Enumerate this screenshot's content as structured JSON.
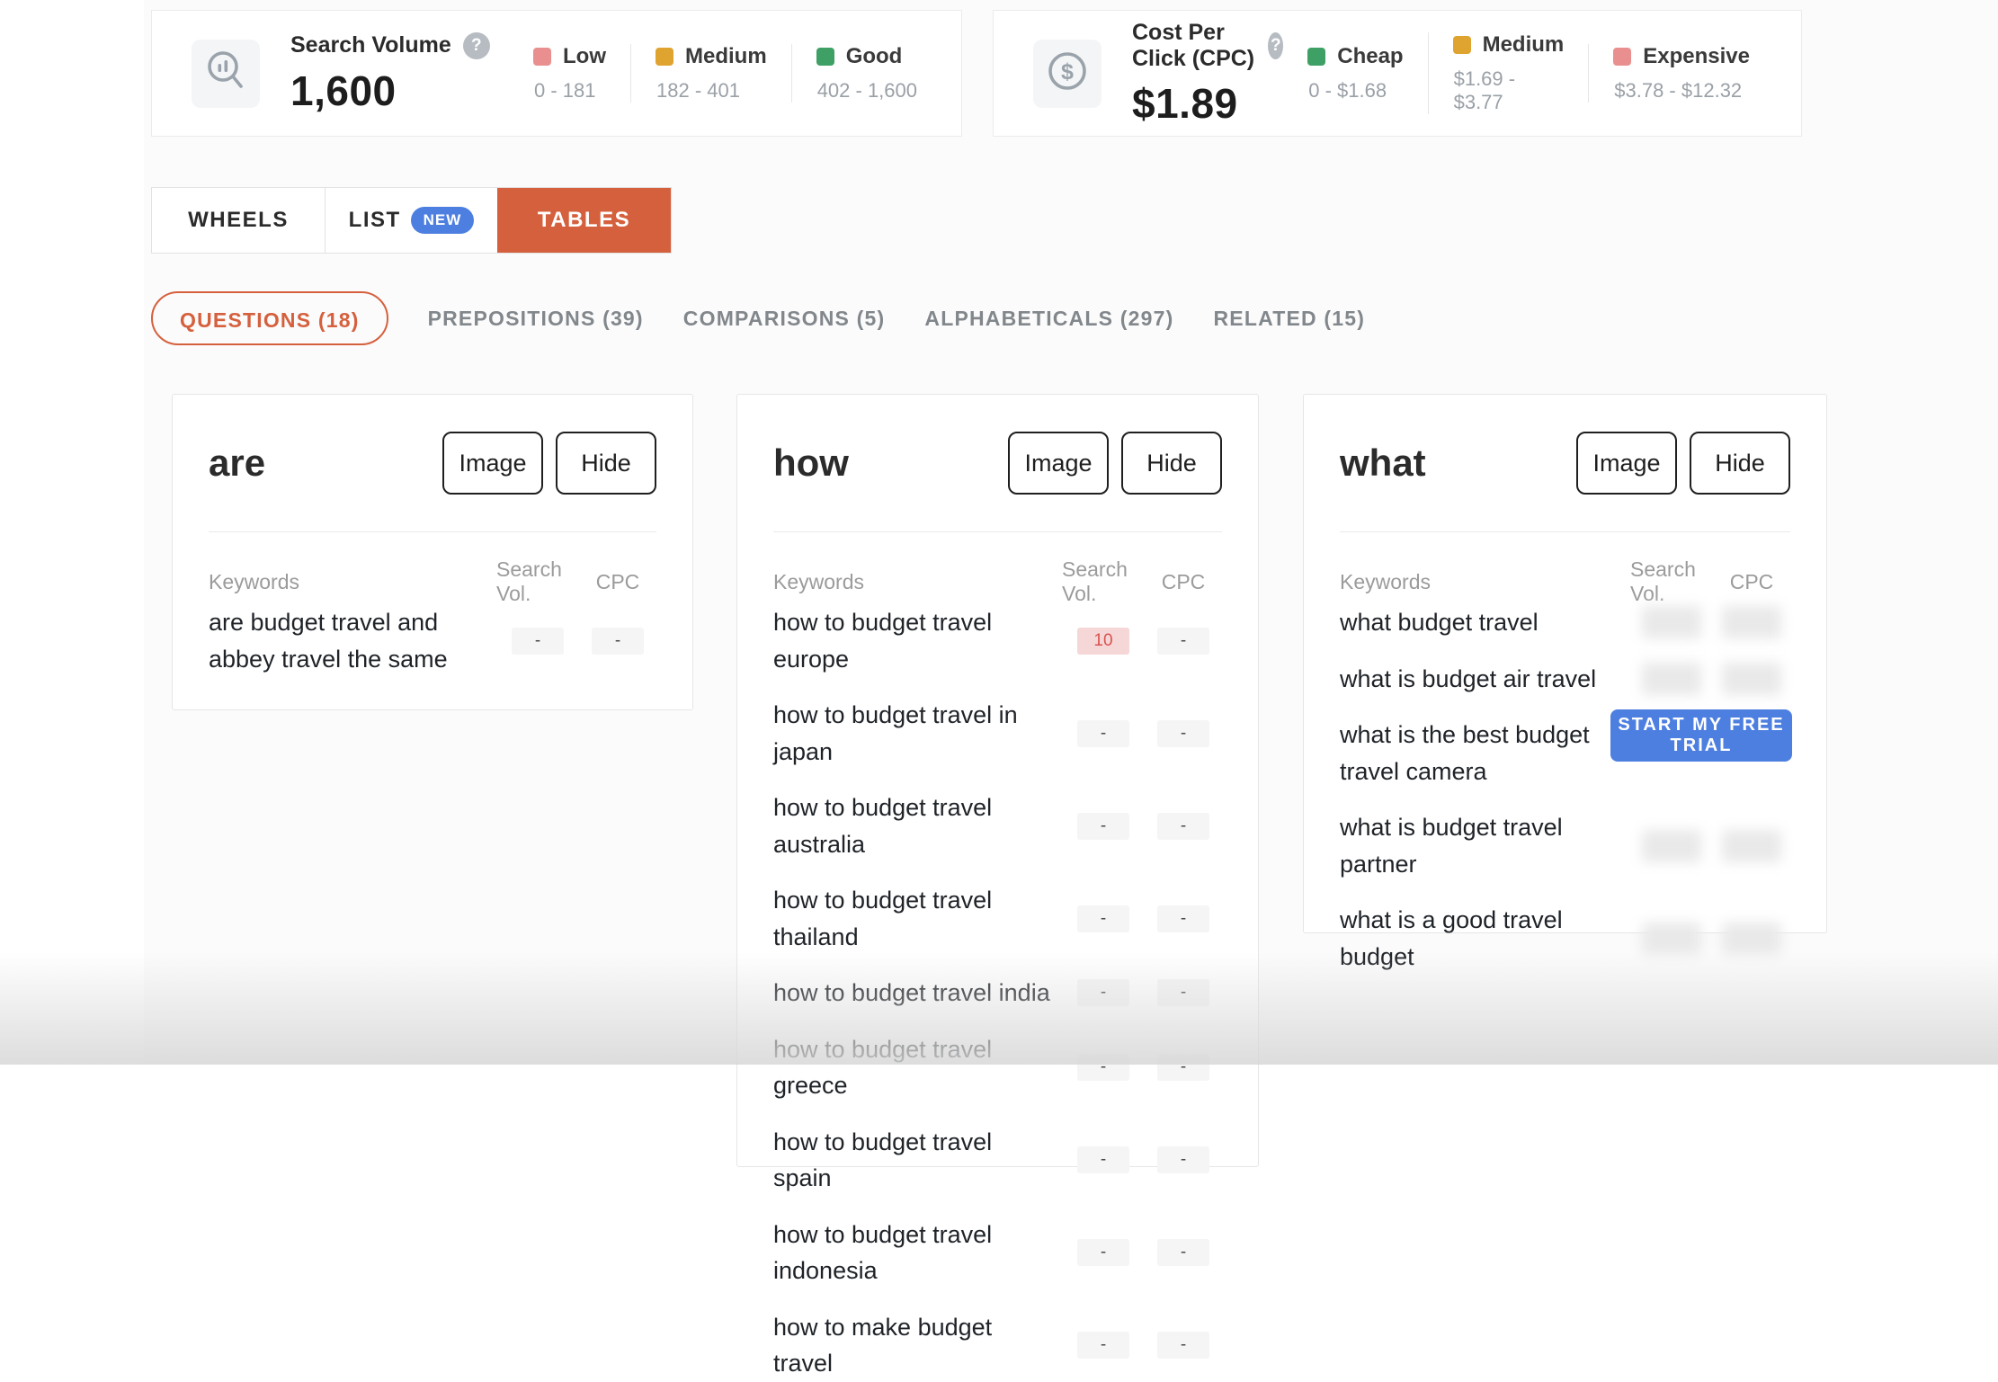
{
  "colors": {
    "accent_orange": "#d5603d",
    "accent_blue": "#4d7fe0",
    "low_pink": "#e98f8f",
    "medium_amber": "#dfa32f",
    "good_green": "#3fa065",
    "highlight_bg": "#f6d7d7",
    "highlight_text": "#d9534f"
  },
  "stats": {
    "search_volume": {
      "title": "Search Volume",
      "value": "1,600",
      "help_icon": "?",
      "legend": [
        {
          "label": "Low",
          "range": "0 - 181",
          "color": "#e98f8f"
        },
        {
          "label": "Medium",
          "range": "182 - 401",
          "color": "#dfa32f"
        },
        {
          "label": "Good",
          "range": "402 - 1,600",
          "color": "#3fa065"
        }
      ]
    },
    "cpc": {
      "title": "Cost Per Click (CPC)",
      "value": "$1.89",
      "help_icon": "?",
      "legend": [
        {
          "label": "Cheap",
          "range": "0 - $1.68",
          "color": "#3fa065"
        },
        {
          "label": "Medium",
          "range": "$1.69 - $3.77",
          "color": "#dfa32f"
        },
        {
          "label": "Expensive",
          "range": "$3.78 - $12.32",
          "color": "#e98f8f"
        }
      ]
    }
  },
  "view_tabs": {
    "wheels": "WHEELS",
    "list": "LIST",
    "list_badge": "NEW",
    "tables": "TABLES"
  },
  "category_tabs": [
    {
      "label": "QUESTIONS (18)",
      "active": true
    },
    {
      "label": "PREPOSITIONS (39)",
      "active": false
    },
    {
      "label": "COMPARISONS (5)",
      "active": false
    },
    {
      "label": "ALPHABETICALS (297)",
      "active": false
    },
    {
      "label": "RELATED (15)",
      "active": false
    }
  ],
  "columns": {
    "keywords": "Keywords",
    "search_vol": "Search Vol.",
    "cpc": "CPC"
  },
  "card_buttons": {
    "image": "Image",
    "hide": "Hide"
  },
  "cards": {
    "are": {
      "title": "are",
      "rows": [
        {
          "keyword": "are budget travel and abbey travel the same",
          "search_vol": "-",
          "cpc": "-"
        }
      ]
    },
    "how": {
      "title": "how",
      "rows": [
        {
          "keyword": "how to budget travel europe",
          "search_vol": "10",
          "cpc": "-",
          "highlight": true
        },
        {
          "keyword": "how to budget travel in japan",
          "search_vol": "-",
          "cpc": "-"
        },
        {
          "keyword": "how to budget travel australia",
          "search_vol": "-",
          "cpc": "-"
        },
        {
          "keyword": "how to budget travel thailand",
          "search_vol": "-",
          "cpc": "-"
        },
        {
          "keyword": "how to budget travel india",
          "search_vol": "-",
          "cpc": "-"
        },
        {
          "keyword": "how to budget travel greece",
          "search_vol": "-",
          "cpc": "-"
        },
        {
          "keyword": "how to budget travel spain",
          "search_vol": "-",
          "cpc": "-"
        },
        {
          "keyword": "how to budget travel indonesia",
          "search_vol": "-",
          "cpc": "-"
        },
        {
          "keyword": "how to make budget travel",
          "search_vol": "-",
          "cpc": "-"
        }
      ]
    },
    "what": {
      "title": "what",
      "cta": "START MY FREE TRIAL",
      "rows": [
        {
          "keyword": "what budget travel",
          "blurred": true
        },
        {
          "keyword": "what is budget air travel",
          "blurred": true
        },
        {
          "keyword": "what is the best budget travel camera",
          "values": "hidden"
        },
        {
          "keyword": "what is budget travel partner",
          "blurred": true
        },
        {
          "keyword": "what is a good travel budget",
          "blurred": true
        }
      ]
    }
  }
}
